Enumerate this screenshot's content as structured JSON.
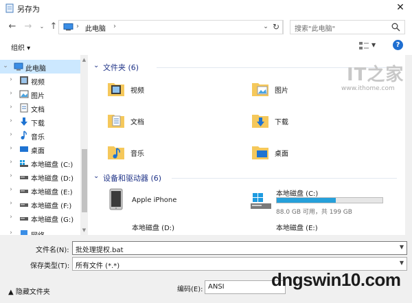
{
  "window": {
    "title": "另存为",
    "close_glyph": "✕"
  },
  "address": {
    "location": "此电脑",
    "separator": "›"
  },
  "search": {
    "placeholder": "搜索\"此电脑\""
  },
  "toolbar": {
    "organize": "组织 ▾"
  },
  "nav_items": [
    {
      "label": "此电脑",
      "icon": "pc-icon",
      "selected": true,
      "expanded": true
    },
    {
      "label": "视频",
      "icon": "video-folder-icon"
    },
    {
      "label": "图片",
      "icon": "pictures-folder-icon"
    },
    {
      "label": "文档",
      "icon": "documents-folder-icon"
    },
    {
      "label": "下载",
      "icon": "download-icon"
    },
    {
      "label": "音乐",
      "icon": "music-icon"
    },
    {
      "label": "桌面",
      "icon": "desktop-icon"
    },
    {
      "label": "本地磁盘 (C:)",
      "icon": "windows-drive-icon"
    },
    {
      "label": "本地磁盘 (D:)",
      "icon": "drive-icon"
    },
    {
      "label": "本地磁盘 (E:)",
      "icon": "drive-icon"
    },
    {
      "label": "本地磁盘 (F:)",
      "icon": "drive-icon"
    },
    {
      "label": "本地磁盘 (G:)",
      "icon": "drive-icon"
    },
    {
      "label": "网络",
      "icon": "network-icon"
    }
  ],
  "groups": {
    "folders": {
      "title": "文件夹 (6)",
      "items": [
        {
          "label": "视频",
          "icon": "video-folder-icon"
        },
        {
          "label": "图片",
          "icon": "pictures-folder-icon"
        },
        {
          "label": "文档",
          "icon": "documents-folder-icon"
        },
        {
          "label": "下载",
          "icon": "download-folder-icon"
        },
        {
          "label": "音乐",
          "icon": "music-folder-icon"
        },
        {
          "label": "桌面",
          "icon": "desktop-folder-icon"
        }
      ]
    },
    "devices": {
      "title": "设备和驱动器 (6)",
      "items": [
        {
          "label": "Apple iPhone",
          "icon": "iphone-device-icon"
        },
        {
          "label": "本地磁盘 (C:)",
          "icon": "windows-drive-icon",
          "free_text": "88.0 GB 可用，共 199 GB",
          "used_fraction": 0.56
        },
        {
          "label": "本地磁盘 (D:)",
          "icon": "drive-icon"
        },
        {
          "label": "本地磁盘 (E:)",
          "icon": "drive-icon"
        }
      ]
    }
  },
  "save": {
    "filename_label": "文件名(N):",
    "filename_value": "批处理提权.bat",
    "type_label": "保存类型(T):",
    "type_value": "所有文件  (*.*)",
    "hide_folders": "▲  隐藏文件夹",
    "encoding_label": "编码(E):",
    "encoding_value": "ANSI"
  },
  "watermarks": {
    "it_logo": "IT之家",
    "it_url": "www.ithome.com",
    "site": "dngswin10.com"
  },
  "colors": {
    "accent": "#1e3287",
    "selection": "#cce8ff",
    "drive_fill": "#26a0da",
    "folder": "#f5c85b"
  }
}
